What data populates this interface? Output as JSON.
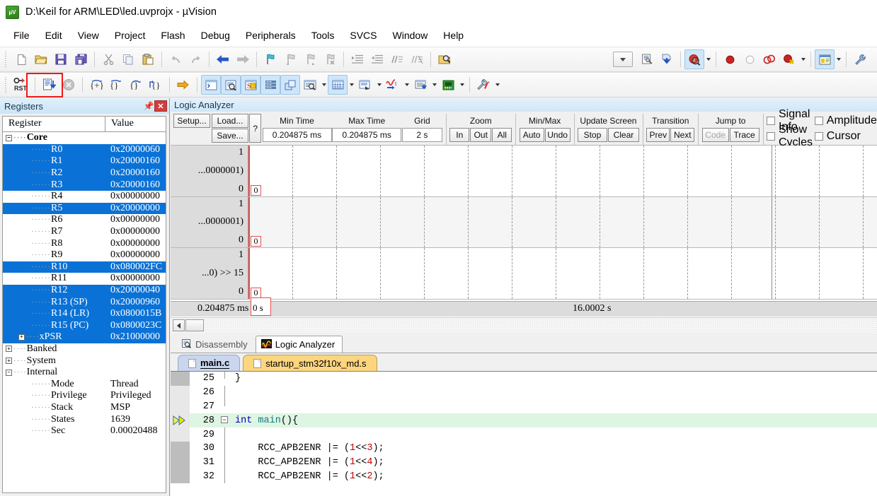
{
  "window": {
    "title": "D:\\Keil for ARM\\LED\\led.uvprojx - µVision",
    "app_icon": "uvision-logo-icon"
  },
  "menubar": {
    "items": [
      "File",
      "Edit",
      "View",
      "Project",
      "Flash",
      "Debug",
      "Peripherals",
      "Tools",
      "SVCS",
      "Window",
      "Help"
    ]
  },
  "toolbar_main": {
    "icons": [
      "new-file-icon",
      "open-file-icon",
      "save-icon",
      "save-all-icon",
      "cut-icon",
      "copy-icon",
      "paste-icon",
      "undo-icon",
      "redo-icon",
      "navigate-back-icon",
      "navigate-forward-icon",
      "bookmark-toggle-icon",
      "bookmark-prev-icon",
      "bookmark-next-icon",
      "bookmark-clear-icon",
      "indent-icon",
      "outdent-icon",
      "comment-icon",
      "uncomment-icon",
      "find-in-files-icon",
      "target-combo-dropdown",
      "options-for-target-icon",
      "build-download-icon",
      "start-stop-debug-icon",
      "start-stop-debug-dropdown",
      "insert-breakpoint-icon",
      "disable-breakpoint-icon",
      "kill-all-breakpoints-icon",
      "disable-all-breakpoints-icon",
      "breakpoint-dropdown",
      "project-window-icon",
      "project-window-dropdown",
      "configure-icon"
    ]
  },
  "toolbar_debug": {
    "icons": [
      "reset-cpu-icon",
      "run-to-cursor-icon",
      "stop-debug-icon",
      "step-into-icon",
      "step-over-icon",
      "step-out-icon",
      "run-to-cursor-line-icon",
      "show-next-statement-icon",
      "command-window-icon",
      "disassembly-window-icon",
      "symbols-window-icon",
      "registers-window-icon",
      "call-stack-window-icon",
      "watch-windows-icon",
      "watch-dropdown",
      "memory-windows-icon",
      "memory-dropdown",
      "serial-windows-icon",
      "serial-dropdown",
      "analysis-windows-icon",
      "analysis-dropdown",
      "trace-windows-icon",
      "trace-dropdown",
      "system-viewer-icon",
      "system-viewer-dropdown",
      "toolbox-icon",
      "toolbox-dropdown"
    ],
    "highlight_note": "red-annotation-rectangle"
  },
  "registers_panel": {
    "title": "Registers",
    "pin_icon": "auto-hide-pin-icon",
    "close_icon": "close-icon",
    "columns": [
      "Register",
      "Value"
    ],
    "rows": [
      {
        "name": "Core",
        "value": "",
        "depth": 0,
        "toggle": "minus",
        "bold": true,
        "highlighted": false
      },
      {
        "name": "R0",
        "value": "0x20000060",
        "depth": 2,
        "toggle": "",
        "bold": false,
        "highlighted": true
      },
      {
        "name": "R1",
        "value": "0x20000160",
        "depth": 2,
        "toggle": "",
        "bold": false,
        "highlighted": true
      },
      {
        "name": "R2",
        "value": "0x20000160",
        "depth": 2,
        "toggle": "",
        "bold": false,
        "highlighted": true
      },
      {
        "name": "R3",
        "value": "0x20000160",
        "depth": 2,
        "toggle": "",
        "bold": false,
        "highlighted": true
      },
      {
        "name": "R4",
        "value": "0x00000000",
        "depth": 2,
        "toggle": "",
        "bold": false,
        "highlighted": false
      },
      {
        "name": "R5",
        "value": "0x20000000",
        "depth": 2,
        "toggle": "",
        "bold": false,
        "highlighted": true
      },
      {
        "name": "R6",
        "value": "0x00000000",
        "depth": 2,
        "toggle": "",
        "bold": false,
        "highlighted": false
      },
      {
        "name": "R7",
        "value": "0x00000000",
        "depth": 2,
        "toggle": "",
        "bold": false,
        "highlighted": false
      },
      {
        "name": "R8",
        "value": "0x00000000",
        "depth": 2,
        "toggle": "",
        "bold": false,
        "highlighted": false
      },
      {
        "name": "R9",
        "value": "0x00000000",
        "depth": 2,
        "toggle": "",
        "bold": false,
        "highlighted": false
      },
      {
        "name": "R10",
        "value": "0x080002FC",
        "depth": 2,
        "toggle": "",
        "bold": false,
        "highlighted": true
      },
      {
        "name": "R11",
        "value": "0x00000000",
        "depth": 2,
        "toggle": "",
        "bold": false,
        "highlighted": false
      },
      {
        "name": "R12",
        "value": "0x20000040",
        "depth": 2,
        "toggle": "",
        "bold": false,
        "highlighted": true
      },
      {
        "name": "R13 (SP)",
        "value": "0x20000960",
        "depth": 2,
        "toggle": "",
        "bold": false,
        "highlighted": true
      },
      {
        "name": "R14 (LR)",
        "value": "0x0800015B",
        "depth": 2,
        "toggle": "",
        "bold": false,
        "highlighted": true
      },
      {
        "name": "R15 (PC)",
        "value": "0x0800023C",
        "depth": 2,
        "toggle": "",
        "bold": false,
        "highlighted": true
      },
      {
        "name": "xPSR",
        "value": "0x21000000",
        "depth": 1,
        "toggle": "plus",
        "bold": false,
        "highlighted": true
      },
      {
        "name": "Banked",
        "value": "",
        "depth": 0,
        "toggle": "plus",
        "bold": false,
        "highlighted": false
      },
      {
        "name": "System",
        "value": "",
        "depth": 0,
        "toggle": "plus",
        "bold": false,
        "highlighted": false
      },
      {
        "name": "Internal",
        "value": "",
        "depth": 0,
        "toggle": "minus",
        "bold": false,
        "highlighted": false
      },
      {
        "name": "Mode",
        "value": "Thread",
        "depth": 2,
        "toggle": "",
        "bold": false,
        "highlighted": false
      },
      {
        "name": "Privilege",
        "value": "Privileged",
        "depth": 2,
        "toggle": "",
        "bold": false,
        "highlighted": false
      },
      {
        "name": "Stack",
        "value": "MSP",
        "depth": 2,
        "toggle": "",
        "bold": false,
        "highlighted": false
      },
      {
        "name": "States",
        "value": "1639",
        "depth": 2,
        "toggle": "",
        "bold": false,
        "highlighted": false
      },
      {
        "name": "Sec",
        "value": "0.00020488",
        "depth": 2,
        "toggle": "",
        "bold": false,
        "highlighted": false
      }
    ]
  },
  "logic_analyzer": {
    "title": "Logic Analyzer",
    "buttons": {
      "setup": "Setup...",
      "load": "Load...",
      "save": "Save...",
      "help": "?"
    },
    "fields": [
      {
        "label": "Min Time",
        "value": "0.204875 ms"
      },
      {
        "label": "Max Time",
        "value": "0.204875 ms"
      },
      {
        "label": "Grid",
        "value": "2 s"
      }
    ],
    "groups": [
      {
        "label": "Zoom",
        "buttons": [
          "In",
          "Out",
          "All"
        ]
      },
      {
        "label": "Min/Max",
        "buttons": [
          "Auto",
          "Undo"
        ]
      },
      {
        "label": "Update Screen",
        "buttons": [
          "Stop",
          "Clear"
        ]
      },
      {
        "label": "Transition",
        "buttons": [
          "Prev",
          "Next"
        ]
      },
      {
        "label": "Jump to",
        "buttons": [
          "Code",
          "Trace"
        ],
        "disabled": [
          "Code"
        ]
      }
    ],
    "checkboxes": [
      {
        "label": "Signal Info",
        "checked": false
      },
      {
        "label": "Amplitude",
        "checked": false
      },
      {
        "label": "Show Cycles",
        "checked": false
      },
      {
        "label": "Cursor",
        "checked": false
      }
    ],
    "signals": [
      {
        "label": "...0000001)",
        "max": "1",
        "min": "0",
        "value_flag": "0"
      },
      {
        "label": "...0000001)",
        "max": "1",
        "min": "0",
        "value_flag": "0"
      },
      {
        "label": "...0) >> 15",
        "max": "1",
        "min": "0",
        "value_flag": "0"
      }
    ],
    "time_axis": {
      "min_label": "0.204875 ms",
      "max_label": "16.0002 s",
      "origin_flag": "0 s"
    },
    "scrollbar": {
      "left_arrow_icon": "scroll-left-icon"
    }
  },
  "window_tabs": [
    {
      "label": "Disassembly",
      "icon": "disassembly-icon",
      "active": false
    },
    {
      "label": "Logic Analyzer",
      "icon": "logic-analyzer-icon",
      "active": true
    }
  ],
  "file_tabs": [
    {
      "label": "main.c",
      "icon": "c-file-icon",
      "active": true
    },
    {
      "label": "startup_stm32f10x_md.s",
      "icon": "asm-file-icon",
      "active": false
    }
  ],
  "editor": {
    "lines": [
      {
        "no": "25",
        "text": "}",
        "current": false,
        "fold": "",
        "vline": "half-up",
        "marker": true
      },
      {
        "no": "26",
        "text": "",
        "current": false,
        "fold": "",
        "vline": "full",
        "marker": false
      },
      {
        "no": "27",
        "text": "",
        "current": false,
        "fold": "end",
        "vline": "half-up",
        "marker": false
      },
      {
        "no": "28",
        "text": "int main(){",
        "current": true,
        "fold": "minus",
        "vline": "",
        "marker": false
      },
      {
        "no": "29",
        "text": "",
        "current": false,
        "fold": "",
        "vline": "full",
        "marker": false
      },
      {
        "no": "30",
        "text": "    RCC_APB2ENR |= (1<<3);",
        "current": false,
        "fold": "",
        "vline": "full",
        "marker": true
      },
      {
        "no": "31",
        "text": "    RCC_APB2ENR |= (1<<4);",
        "current": false,
        "fold": "",
        "vline": "full",
        "marker": true
      },
      {
        "no": "32",
        "text": "    RCC_APB2ENR |= (1<<2);",
        "current": false,
        "fold": "",
        "vline": "full",
        "marker": true
      }
    ],
    "pc_marker_icon": "program-counter-arrow-icon"
  },
  "colors": {
    "selection_blue": "#0a72d6",
    "annotation_red": "#f01818",
    "current_line_green": "#dff5e3",
    "signal_axis_red": "#ef4747",
    "tab_active_blue": "#c9d6ee",
    "tab_inactive_amber": "#fcd67f"
  }
}
